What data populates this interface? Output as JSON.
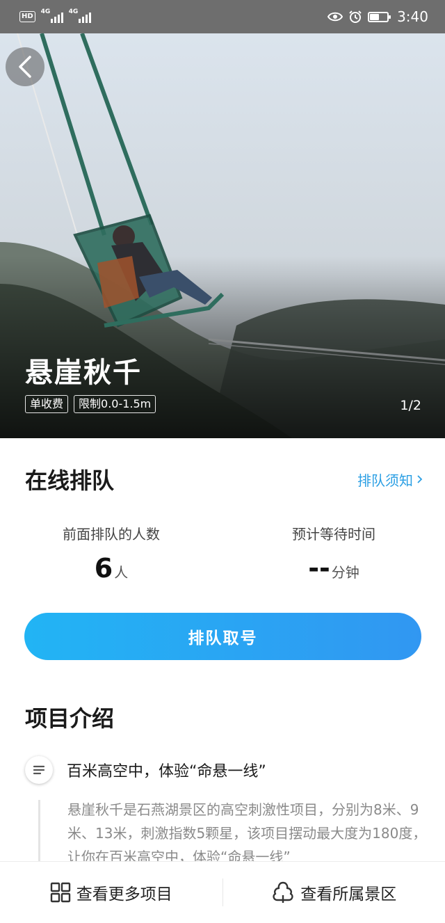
{
  "status_bar": {
    "hd": "HD",
    "network_1": "4G",
    "network_2": "4G",
    "time": "3:40",
    "battery_level": 0.55
  },
  "hero": {
    "title": "悬崖秋千",
    "tags": [
      "单收费",
      "限制0.0-1.5m"
    ],
    "counter": "1/2",
    "back_icon": "chevron-left-icon"
  },
  "queue": {
    "title": "在线排队",
    "notice_link": "排队须知",
    "ahead_label": "前面排队的人数",
    "ahead_value": "6",
    "ahead_unit": "人",
    "wait_label": "预计等待时间",
    "wait_value": "--",
    "wait_unit": "分钟",
    "button_label": "排队取号"
  },
  "intro": {
    "title": "项目介绍",
    "item_heading": "百米高空中，体验“命悬一线”",
    "item_body": "悬崖秋千是石燕湖景区的高空刺激性项目，分别为8米、9米、13米，刺激指数5颗星，该项目摆动最大度为180度，让你在百米高空中，体验“命悬一线”"
  },
  "bottom_bar": {
    "more_projects": "查看更多项目",
    "view_scenic": "查看所属景区"
  },
  "colors": {
    "accent": "#2b9fe4",
    "button_start": "#22b4f4",
    "button_end": "#3197f2",
    "status_bar": "#6e6e6e"
  }
}
